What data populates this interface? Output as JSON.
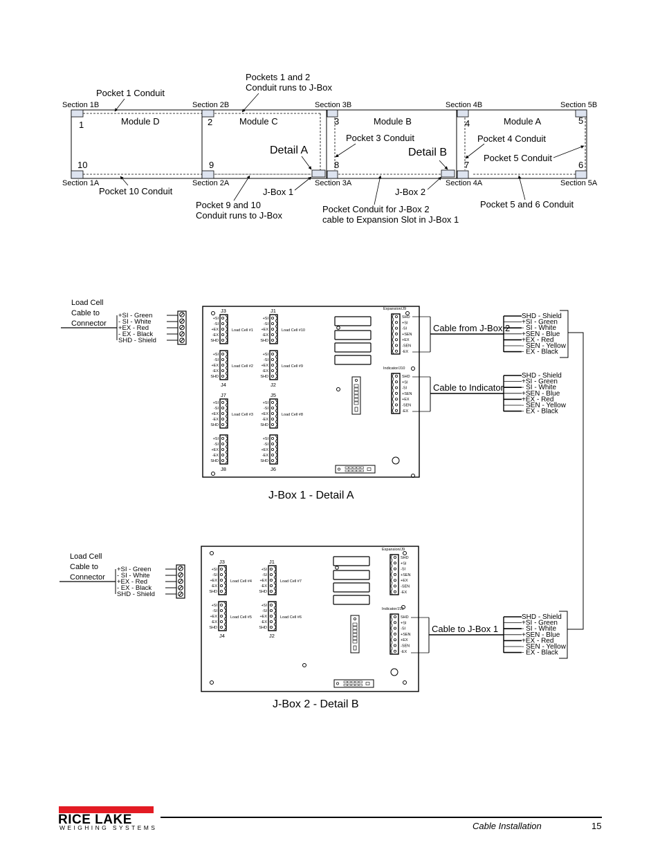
{
  "layout_diagram": {
    "sections_top": [
      "Section 1B",
      "Section 2B",
      "Section 3B",
      "Section 4B",
      "Section 5B"
    ],
    "sections_bottom": [
      "Section 1A",
      "Section 2A",
      "Section 3A",
      "Section 4A",
      "Section 5A"
    ],
    "modules": [
      "Module D",
      "Module C",
      "Module B",
      "Module A"
    ],
    "pocket_numbers": [
      "1",
      "2",
      "3",
      "4",
      "5",
      "10",
      "9",
      "8",
      "7",
      "6"
    ],
    "callouts": {
      "pocket1": "Pocket 1 Conduit",
      "pockets12_line1": "Pockets 1 and 2",
      "pockets12_line2": "Conduit runs to J-Box",
      "pocket10": "Pocket 10 Conduit",
      "pocket910_line1": "Pocket 9 and 10",
      "pocket910_line2": "Conduit runs to J-Box",
      "jbox1": "J-Box 1",
      "jbox2": "J-Box 2",
      "pocket3": "Pocket 3 Conduit",
      "pocket4": "Pocket 4 Conduit",
      "pocket5": "Pocket 5 Conduit",
      "pocket56": "Pocket 5 and 6 Conduit",
      "jbox2cable_line1": "Pocket Conduit for J-Box 2",
      "jbox2cable_line2": "cable to Expansion Slot in J-Box 1",
      "detailA": "Detail A",
      "detailB": "Detail B"
    }
  },
  "jbox1": {
    "title": "J-Box 1 - Detail A",
    "load_cell_label": [
      "Load Cell",
      "Cable to",
      "Connector"
    ],
    "load_cell_wires": [
      "+SI - Green",
      "- SI - White",
      "+EX - Red",
      "- EX - Black",
      "SHD - Shield"
    ],
    "connectors": [
      {
        "id": "J3",
        "load_cell": "Load Cell #1"
      },
      {
        "id": "J1",
        "load_cell": "Load Cell #10"
      },
      {
        "id": "J4",
        "load_cell": "Load Cell #2"
      },
      {
        "id": "J2",
        "load_cell": "Load Cell #9"
      },
      {
        "id": "J7",
        "load_cell": "Load Cell #3"
      },
      {
        "id": "J5",
        "load_cell": "Load Cell #8"
      },
      {
        "id": "J8",
        "load_cell": ""
      },
      {
        "id": "J6",
        "load_cell": ""
      }
    ],
    "pins": [
      "+SI",
      "-SI",
      "+EX",
      "-EX",
      "SHD"
    ],
    "expansion_label": "Expansion/J9",
    "indicator_label": "Indicator/J10",
    "terminal_pins": [
      "SHD",
      "+SI",
      "-SI",
      "+SEN",
      "+EX",
      "-SEN",
      "-EX"
    ],
    "cable_from_jbox2": "Cable from J-Box 2",
    "cable_to_indicator": "Cable to Indicator",
    "cable_wires": [
      "SHD - Shield",
      "+SI - Green",
      "- SI - White",
      "+SEN - Blue",
      "+EX - Red",
      "- SEN - Yellow",
      "- EX - Black"
    ]
  },
  "jbox2": {
    "title": "J-Box 2 - Detail B",
    "load_cell_label": [
      "Load Cell",
      "Cable to",
      "Connector"
    ],
    "load_cell_wires": [
      "+SI - Green",
      "- SI - White",
      "+EX - Red",
      "- EX - Black",
      "SHD - Shield"
    ],
    "connectors": [
      {
        "id": "J3",
        "load_cell": "Load Cell #4"
      },
      {
        "id": "J1",
        "load_cell": "Load Cell #7"
      },
      {
        "id": "J4",
        "load_cell": "Load Cell #5"
      },
      {
        "id": "J2",
        "load_cell": "Load Cell #6"
      }
    ],
    "pins": [
      "+SI",
      "-SI",
      "+EX",
      "-EX",
      "SHD"
    ],
    "expansion_label": "Expansion/J9",
    "indicator_label": "Indicator/J10",
    "terminal_pins": [
      "SHD",
      "+SI",
      "-SI",
      "+SEN",
      "+EX",
      "-SEN",
      "-EX"
    ],
    "cable_to_jbox1": "Cable to J-Box 1",
    "cable_wires": [
      "SHD - Shield",
      "+SI - Green",
      "- SI - White",
      "+SEN - Blue",
      "+EX - Red",
      "- SEN - Yellow",
      "- EX - Black"
    ]
  },
  "footer": {
    "brand": "RICE LAKE",
    "brand_sub": "WEIGHING SYSTEMS",
    "section": "Cable Installation",
    "page": "15",
    "brand_color": "#e31b23"
  }
}
